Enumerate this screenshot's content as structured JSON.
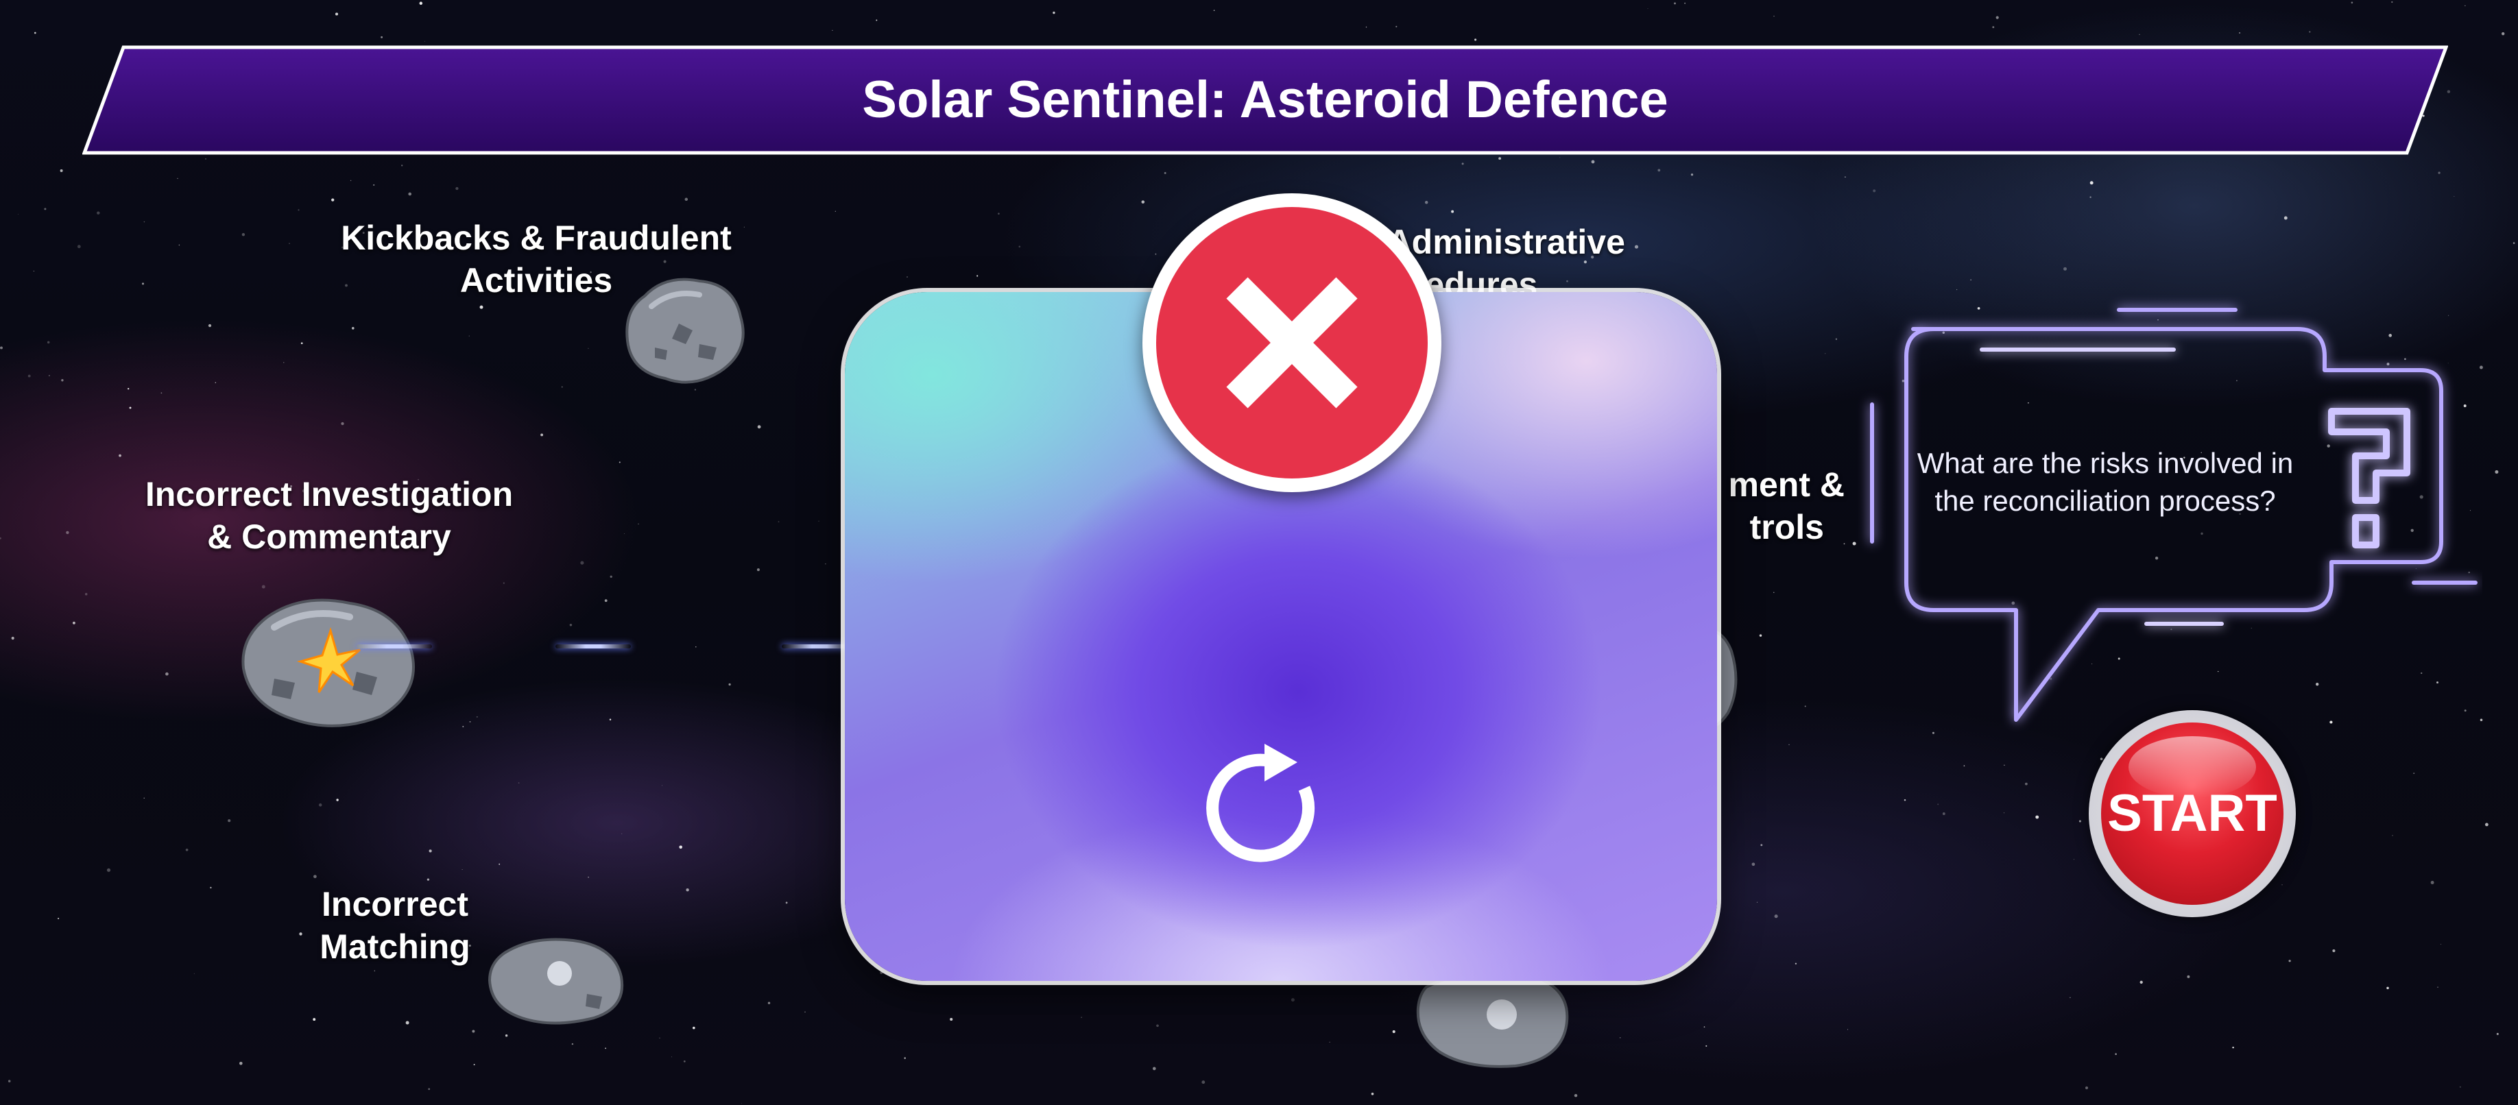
{
  "game": {
    "title": "Solar Sentinel: Asteroid Defence"
  },
  "asteroids": [
    {
      "label_line1": "Kickbacks & Fraudulent",
      "label_line2": "Activities",
      "icon": "asteroid-icon"
    },
    {
      "label_line1": "Incorrect Investigation",
      "label_line2": "& Commentary",
      "icon": "asteroid-hit-icon"
    },
    {
      "label_line1": "Incorrect",
      "label_line2": "Matching",
      "icon": "asteroid-icon"
    },
    {
      "label_line1": "d Administrative",
      "label_line2": "ocedures",
      "icon": "asteroid-icon"
    },
    {
      "label_line1": "ment &",
      "label_line2": "trols",
      "icon": "asteroid-icon"
    }
  ],
  "question": {
    "text": "What are the risks involved in the reconciliation process?",
    "icon": "question-mark-icon"
  },
  "start_button": {
    "label": "START"
  },
  "modal": {
    "close_icon": "close-icon",
    "retry_icon": "retry-icon"
  },
  "colors": {
    "banner": "#3a0a7a",
    "start_red": "#e0202e",
    "close_red": "#e6334a",
    "neon": "#8a6cff"
  }
}
